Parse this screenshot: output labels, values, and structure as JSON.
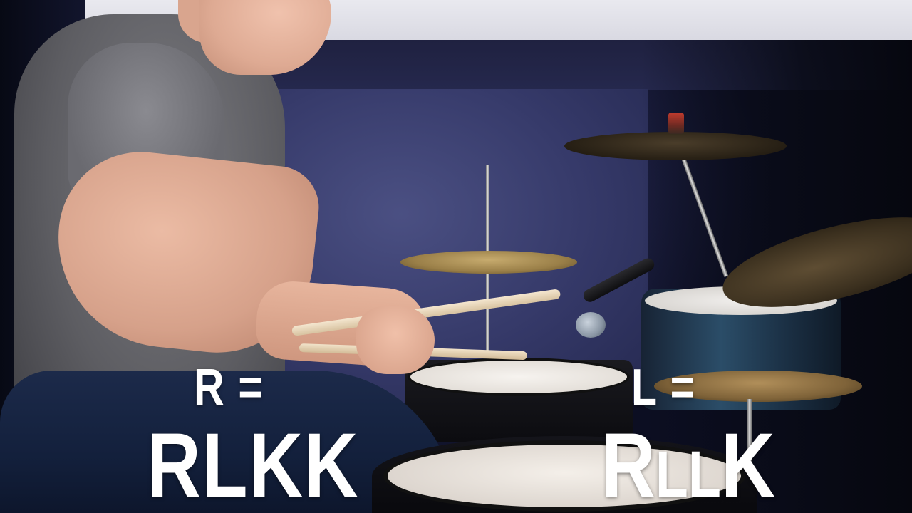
{
  "overlay": {
    "left": {
      "label": "R =",
      "pattern": "RLKK"
    },
    "right": {
      "label": "L =",
      "pattern": {
        "first": "R",
        "small": "LL",
        "last": "K"
      }
    }
  }
}
